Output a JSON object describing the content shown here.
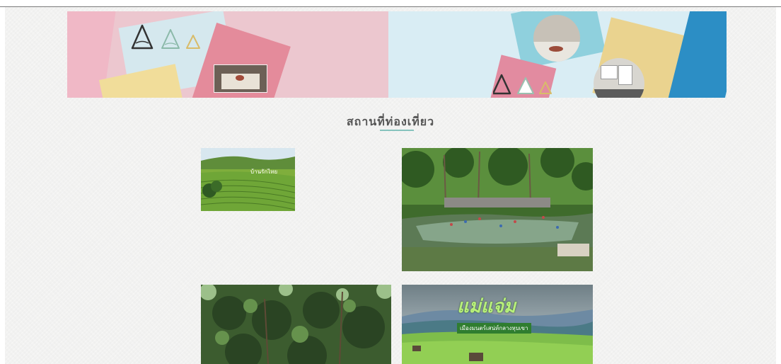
{
  "section": {
    "title": "สถานที่ท่องเที่ยว"
  },
  "photos": [
    {
      "id": "tea-field",
      "caption": "บ้านรักไทย"
    },
    {
      "id": "hot-spring",
      "caption": ""
    },
    {
      "id": "forest",
      "caption": ""
    },
    {
      "id": "mae-jaem",
      "title": "แม่แจ่ม",
      "subtitle": "เมืองมนตร์เสน่ห์กลางหุบเขา"
    }
  ],
  "colors": {
    "accent": "#86c3bd",
    "banner_pink": "#ecc7cf",
    "banner_blue": "#d9edf4"
  }
}
